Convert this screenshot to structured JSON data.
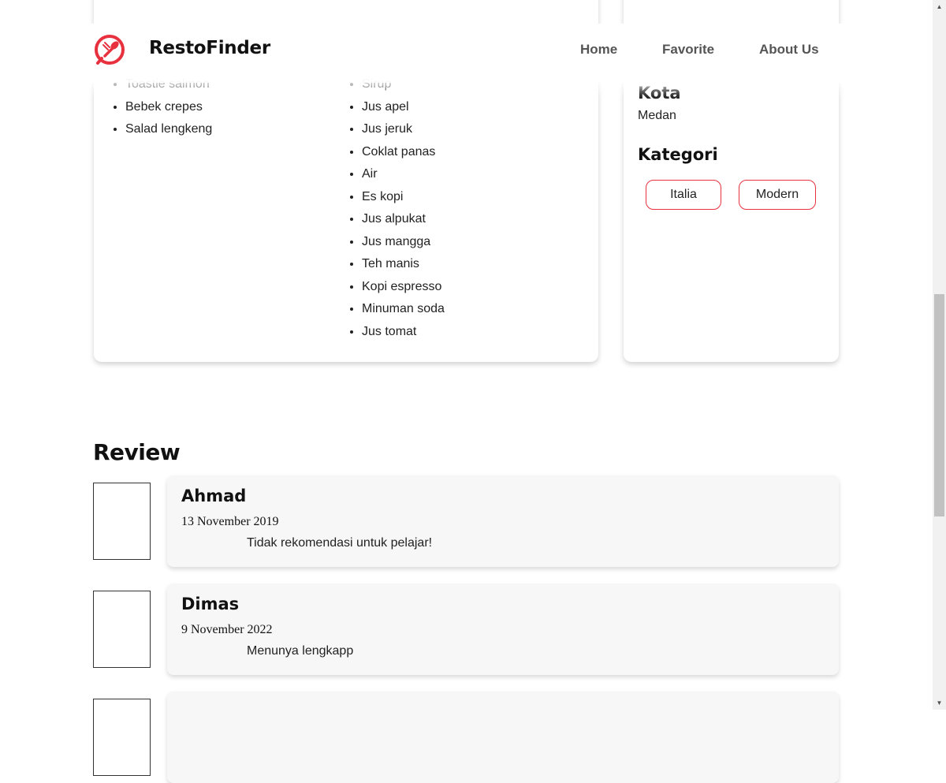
{
  "header": {
    "brand": "RestoFinder",
    "nav": [
      "Home",
      "Favorite",
      "About Us"
    ],
    "accent_color": "#e8313f",
    "logo_icon": "fork-spoon-logo-icon"
  },
  "menu": {
    "foods_visible": [
      "Toastie salmon",
      "Bebek crepes",
      "Salad lengkeng"
    ],
    "drinks_visible": [
      "Sirup",
      "Jus apel",
      "Jus jeruk",
      "Coklat panas",
      "Air",
      "Es kopi",
      "Jus alpukat",
      "Jus mangga",
      "Teh manis",
      "Kopi espresso",
      "Minuman soda",
      "Jus tomat"
    ]
  },
  "info": {
    "city_label": "Kota",
    "city_value": "Medan",
    "category_label": "Kategori",
    "categories": [
      "Italia",
      "Modern"
    ],
    "chip_border_color": "#e8313f"
  },
  "review": {
    "heading": "Review",
    "items": [
      {
        "name": "Ahmad",
        "date": "13 November 2019",
        "text": "Tidak rekomendasi untuk pelajar!"
      },
      {
        "name": "Dimas",
        "date": "9 November 2022",
        "text": "Menunya lengkapp"
      }
    ]
  }
}
